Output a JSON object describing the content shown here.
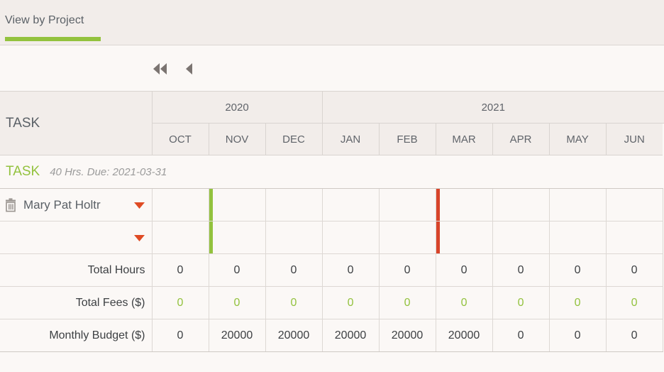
{
  "tab": {
    "label": "View by Project",
    "accent_color": "#93c23e"
  },
  "pager": {
    "first_label": "skip-to-start",
    "prev_label": "previous-period"
  },
  "table": {
    "corner_label": "TASK",
    "year_groups": [
      {
        "label": "2020",
        "span": 3
      },
      {
        "label": "2021",
        "span": 9
      }
    ],
    "months": [
      "OCT",
      "NOV",
      "DEC",
      "JAN",
      "FEB",
      "MAR",
      "APR",
      "MAY",
      "JUN"
    ],
    "group": {
      "name": "TASK",
      "meta": "40 Hrs. Due: 2021-03-31"
    },
    "assignees": [
      {
        "name": "Mary Pat Holtr",
        "has_trash": true,
        "has_caret": true,
        "markers": [
          {
            "month_index": 1,
            "color": "#93c23e",
            "name": "start-marker"
          },
          {
            "month_index": 5,
            "color": "#d8442a",
            "name": "due-marker"
          }
        ]
      },
      {
        "name": "",
        "has_trash": false,
        "has_caret": true,
        "markers": [
          {
            "month_index": 1,
            "color": "#93c23e",
            "name": "start-marker"
          },
          {
            "month_index": 5,
            "color": "#d8442a",
            "name": "due-marker"
          }
        ]
      }
    ],
    "totals": [
      {
        "label": "Total Hours",
        "values": [
          "0",
          "0",
          "0",
          "0",
          "0",
          "0",
          "0",
          "0",
          "0"
        ],
        "value_color": "#3d4043"
      },
      {
        "label": "Total Fees ($)",
        "values": [
          "0",
          "0",
          "0",
          "0",
          "0",
          "0",
          "0",
          "0",
          "0"
        ],
        "value_color": "#93c23e"
      },
      {
        "label": "Monthly Budget ($)",
        "values": [
          "0",
          "20000",
          "20000",
          "20000",
          "20000",
          "20000",
          "0",
          "0",
          "0"
        ],
        "value_color": "#3d4043"
      }
    ]
  }
}
